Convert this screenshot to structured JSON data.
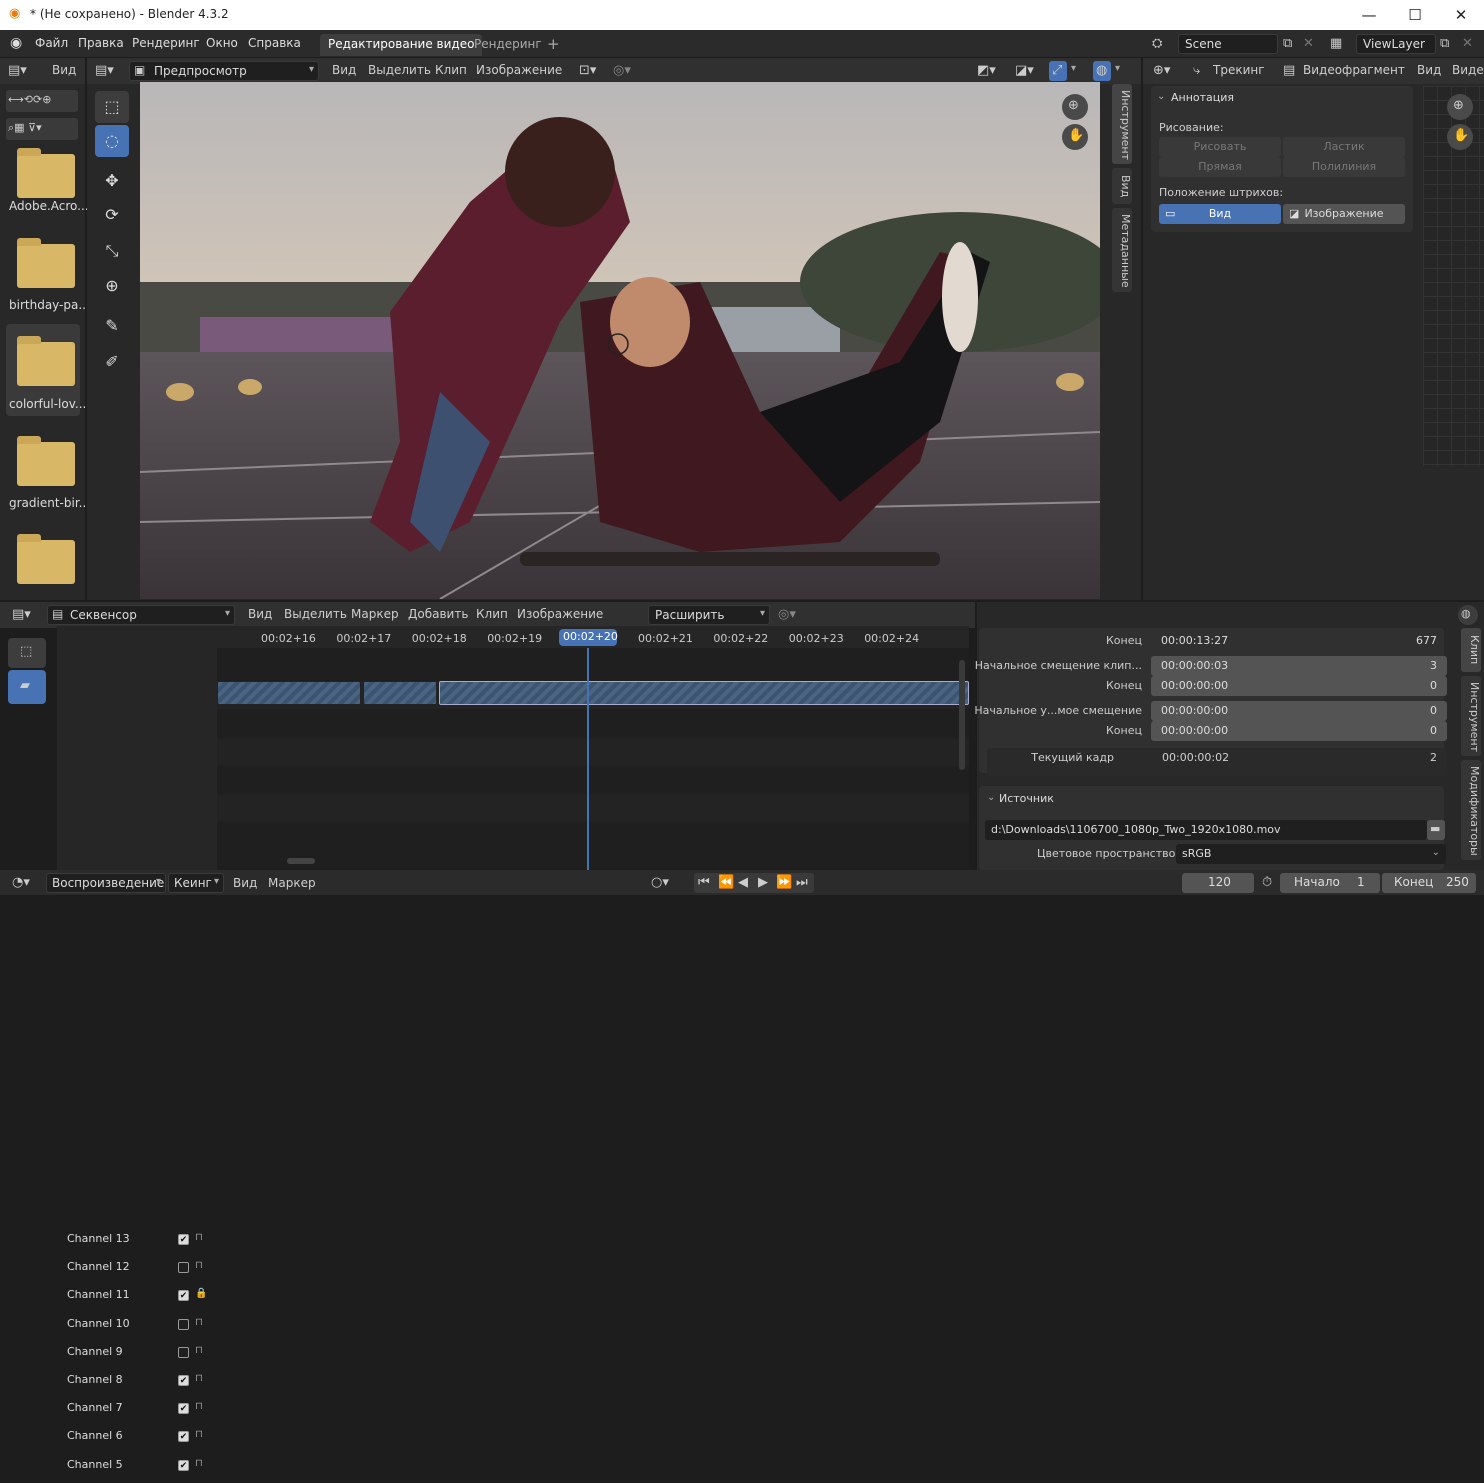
{
  "window": {
    "title": "* (Не сохранено) - Blender 4.3.2"
  },
  "menu": [
    "Файл",
    "Правка",
    "Рендеринг",
    "Окно",
    "Справка"
  ],
  "workspace_tabs": [
    "Редактирование видео",
    "Рендеринг"
  ],
  "scene": {
    "name": "Scene",
    "view_layer": "ViewLayer"
  },
  "file_browser": {
    "view_label": "Вид",
    "items": [
      "Adobe.Acro...",
      "birthday-pa...",
      "colorful-lov...",
      "gradient-bir..."
    ]
  },
  "preview_header": {
    "mode": "Предпросмотр",
    "menus": [
      "Вид",
      "Выделить",
      "Клип",
      "Изображение"
    ]
  },
  "preview_side_tabs": [
    "Инструмент",
    "Вид",
    "Метаданные"
  ],
  "clip_header": {
    "tracking": "Трекинг",
    "clip_mode": "Видеофрагмент",
    "view": "Вид",
    "video": "Видео"
  },
  "annotation": {
    "title": "Аннотация",
    "drawing_label": "Рисование:",
    "draw": "Рисовать",
    "eraser": "Ластик",
    "line": "Прямая",
    "polyline": "Полилиния",
    "placement_label": "Положение штрихов:",
    "view": "Вид",
    "image": "Изображение"
  },
  "sequencer_header": {
    "mode": "Секвенсор",
    "menus": [
      "Вид",
      "Выделить",
      "Маркер",
      "Добавить",
      "Клип",
      "Изображение"
    ],
    "expand": "Расширить"
  },
  "channels": [
    {
      "name": "Channel 13",
      "checked": true,
      "locked": false
    },
    {
      "name": "Channel 12",
      "checked": false,
      "locked": false
    },
    {
      "name": "Channel 11",
      "checked": true,
      "locked": true
    },
    {
      "name": "Channel 10",
      "checked": false,
      "locked": false
    },
    {
      "name": "Channel 9",
      "checked": false,
      "locked": false
    },
    {
      "name": "Channel 8",
      "checked": true,
      "locked": false
    },
    {
      "name": "Channel 7",
      "checked": true,
      "locked": false
    },
    {
      "name": "Channel 6",
      "checked": true,
      "locked": false
    },
    {
      "name": "Channel 5",
      "checked": true,
      "locked": false
    }
  ],
  "timeline": {
    "ticks": [
      "00:02+16",
      "00:02+17",
      "00:02+18",
      "00:02+19",
      "00:02+20",
      "00:02+21",
      "00:02+22",
      "00:02+23",
      "00:02+24"
    ],
    "current": "00:02+20"
  },
  "strip_props": {
    "rows": [
      {
        "label": "Конец",
        "time": "00:00:13:27",
        "frames": "677"
      },
      {
        "label": "Начальное смещение клип...",
        "time": "00:00:00:03",
        "frames": "3"
      },
      {
        "label": "Конец",
        "time": "00:00:00:00",
        "frames": "0"
      },
      {
        "label": "Начальное у...мое смещение",
        "time": "00:00:00:00",
        "frames": "0"
      },
      {
        "label": "Конец",
        "time": "00:00:00:00",
        "frames": "0"
      }
    ],
    "current_frame_label": "Текущий кадр",
    "current_frame_time": "00:00:00:02",
    "current_frame_num": "2",
    "source_title": "Источник",
    "source_path": "d:\\Downloads\\1106700_1080p_Two_1920x1080.mov",
    "color_space_label": "Цветовое пространство",
    "color_space": "sRGB"
  },
  "props_side_tabs": [
    "Клип",
    "Инструмент",
    "Модификаторы"
  ],
  "playback": {
    "playback": "Воспроизведение",
    "keying": "Кеинг",
    "view": "Вид",
    "marker": "Маркер",
    "frame": "120",
    "start_label": "Начало",
    "start": "1",
    "end_label": "Конец",
    "end": "250"
  }
}
